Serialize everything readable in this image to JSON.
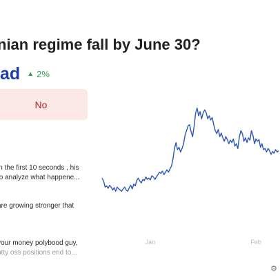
{
  "market": {
    "title": "nian regime fall by June 30?",
    "outcome_name": "ad",
    "change_arrow": "▲",
    "change": "2%",
    "no_label": "No"
  },
  "comments": [
    {
      "line1": "in the first 10 seconds , his",
      "line2": "to analyze what happene..."
    },
    {
      "line1": "are growing stronger that",
      "line2": ""
    },
    {
      "line1": "your money polybood guy,",
      "line2": "btty oss positions end to..."
    }
  ],
  "chart_data": {
    "type": "line",
    "x_tick_labels": [
      "Jan",
      "Feb"
    ],
    "color": "#2a55b8",
    "series": [
      {
        "values": [
          60,
          55,
          45,
          47,
          43,
          48,
          45,
          40,
          44,
          38,
          45,
          42,
          40,
          38,
          42,
          45,
          40,
          38,
          44,
          48,
          42,
          50,
          47,
          56,
          60,
          55,
          52,
          58,
          56,
          62,
          58,
          60,
          57,
          64,
          62,
          58,
          62,
          66,
          70,
          68,
          72,
          66,
          70,
          74,
          70,
          76,
          80,
          92,
          110,
          120,
          108,
          112,
          104,
          110,
          118,
          132,
          140,
          148,
          150,
          138,
          130,
          148,
          170,
          178,
          165,
          172,
          160,
          170,
          175,
          170,
          160,
          165,
          158,
          162,
          150,
          140,
          135,
          142,
          130,
          136,
          128,
          122,
          130,
          125,
          118,
          124,
          120,
          126,
          114,
          118,
          110,
          130,
          140,
          135,
          122,
          128,
          120,
          128,
          124,
          140,
          132,
          118,
          126,
          122,
          125,
          112,
          118,
          108,
          110,
          104,
          110,
          106,
          100,
          105,
          102,
          108,
          104,
          106
        ]
      }
    ]
  }
}
